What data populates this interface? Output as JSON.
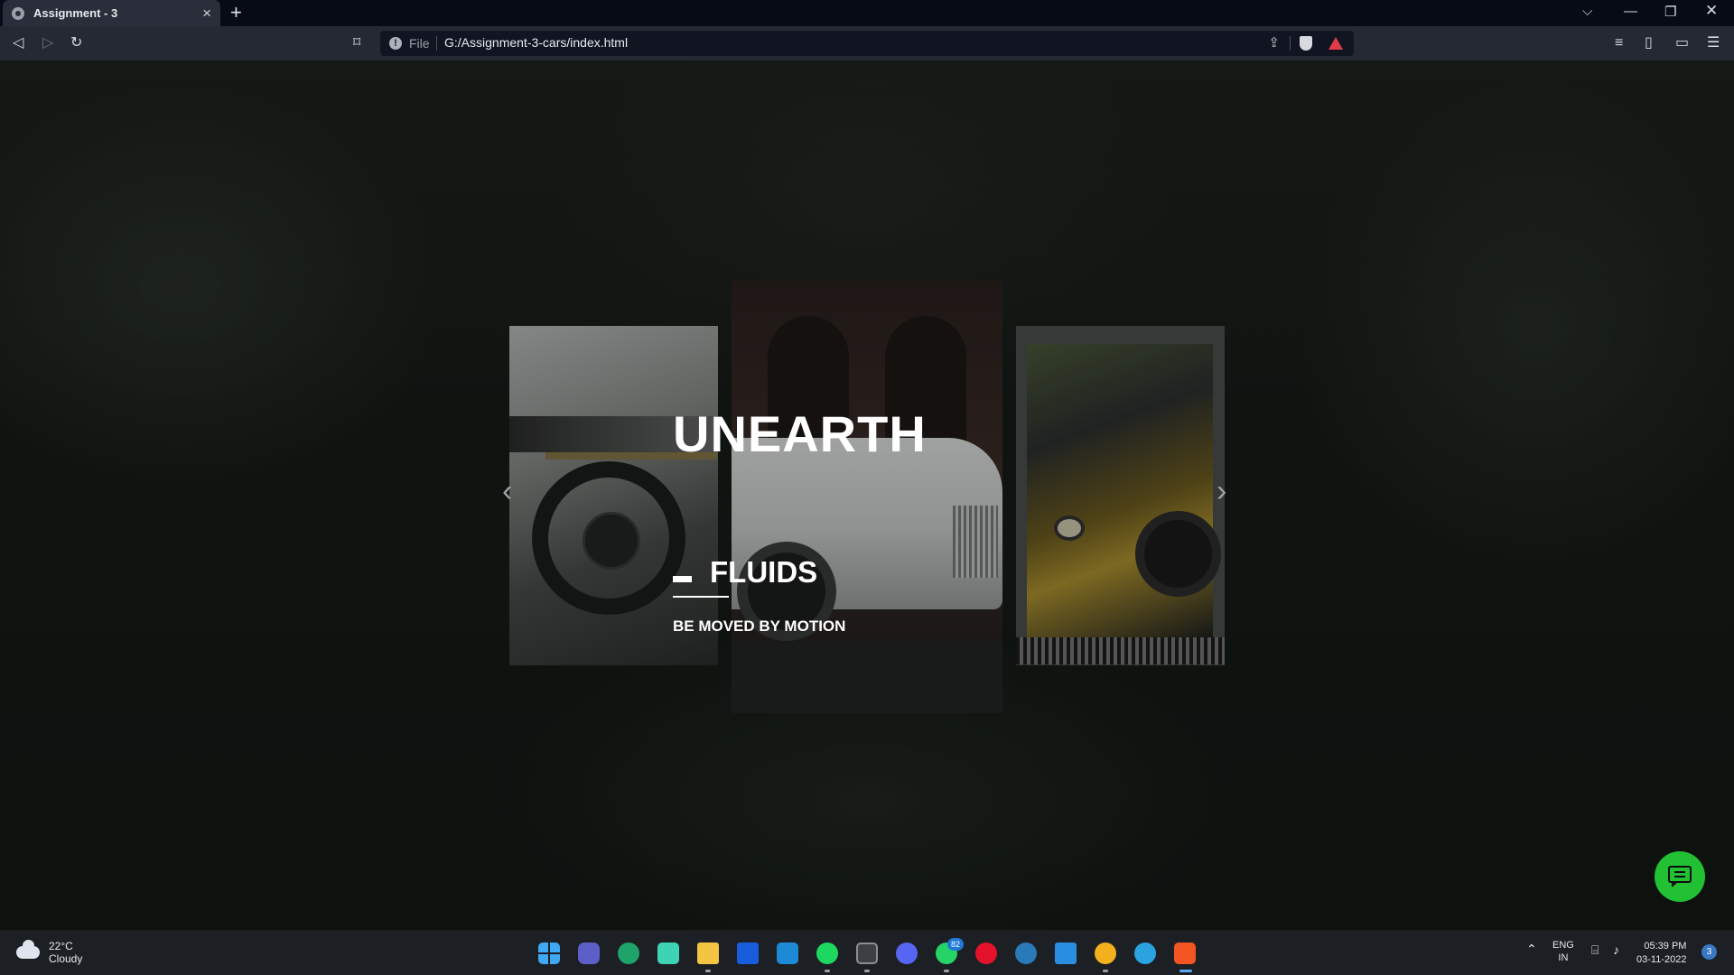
{
  "browser": {
    "tab_title": "Assignment - 3",
    "new_tab_label": "+",
    "url_scheme": "File",
    "url": "G:/Assignment-3-cars/index.html"
  },
  "page": {
    "hero": {
      "title": "UNEARTH",
      "subtitle": "FLUIDS",
      "tagline": "BE MOVED BY MOTION"
    },
    "slider": {
      "prev_arrow": "‹",
      "next_arrow": "›",
      "slides": [
        "car-interior-steering-wheel",
        "white-rolls-royce-front",
        "gold-rolls-royce-front"
      ]
    },
    "chat_button": {
      "icon": "chat-icon",
      "color": "#22c134"
    }
  },
  "taskbar": {
    "weather": {
      "temp": "22°C",
      "condition": "Cloudy"
    },
    "apps": [
      "windows-start",
      "teams",
      "edge",
      "clipchamp",
      "file-explorer",
      "bitwarden",
      "vscode",
      "spotify",
      "terminal",
      "discord",
      "whatsapp",
      "opera",
      "steam",
      "mail",
      "chrome",
      "telegram",
      "brave"
    ],
    "whatsapp_badge": "82",
    "language": {
      "line1": "ENG",
      "line2": "IN"
    },
    "time": "05:39 PM",
    "date": "03-11-2022",
    "notification_count": "3"
  }
}
